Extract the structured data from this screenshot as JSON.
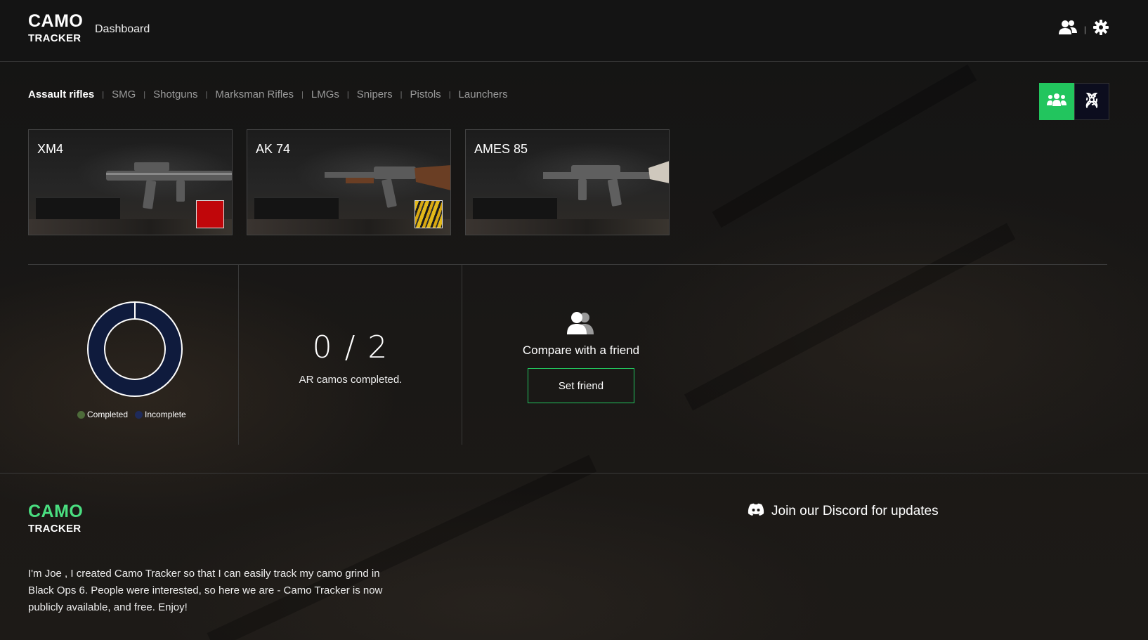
{
  "app": {
    "logo_line1": "CAMO",
    "logo_line2": "TRACKER",
    "nav_dashboard": "Dashboard",
    "accent_color": "#22c55e"
  },
  "header_icons": [
    "users-icon",
    "settings-icon"
  ],
  "tabs": [
    {
      "label": "Assault rifles",
      "active": true
    },
    {
      "label": "SMG",
      "active": false
    },
    {
      "label": "Shotguns",
      "active": false
    },
    {
      "label": "Marksman Rifles",
      "active": false
    },
    {
      "label": "LMGs",
      "active": false
    },
    {
      "label": "Snipers",
      "active": false
    },
    {
      "label": "Pistols",
      "active": false
    },
    {
      "label": "Launchers",
      "active": false
    }
  ],
  "mode_toggle": {
    "options": [
      "multiplayer-icon",
      "zombies-icon"
    ],
    "active": "multiplayer-icon"
  },
  "weapons": [
    {
      "name": "XM4",
      "camo": "red"
    },
    {
      "name": "AK 74",
      "camo": "tiger"
    },
    {
      "name": "AMES 85",
      "camo": null
    }
  ],
  "progress": {
    "completed": 0,
    "total": 2,
    "count_text": "0 / 2",
    "label": "AR camos completed.",
    "legend": [
      {
        "label": "Completed",
        "color": "#4d6b3a"
      },
      {
        "label": "Incomplete",
        "color": "#1e2a5a"
      }
    ],
    "donut_color": "#0f1b3d"
  },
  "friend": {
    "title": "Compare with a friend",
    "button": "Set friend"
  },
  "footer": {
    "logo_line1": "CAMO",
    "logo_line2": "TRACKER",
    "description": "I'm Joe , I created Camo Tracker so that I can easily track my camo grind in Black Ops 6. People were interested, so here we are - Camo Tracker is now publicly available, and free. Enjoy!",
    "discord": "Join our Discord for updates"
  }
}
